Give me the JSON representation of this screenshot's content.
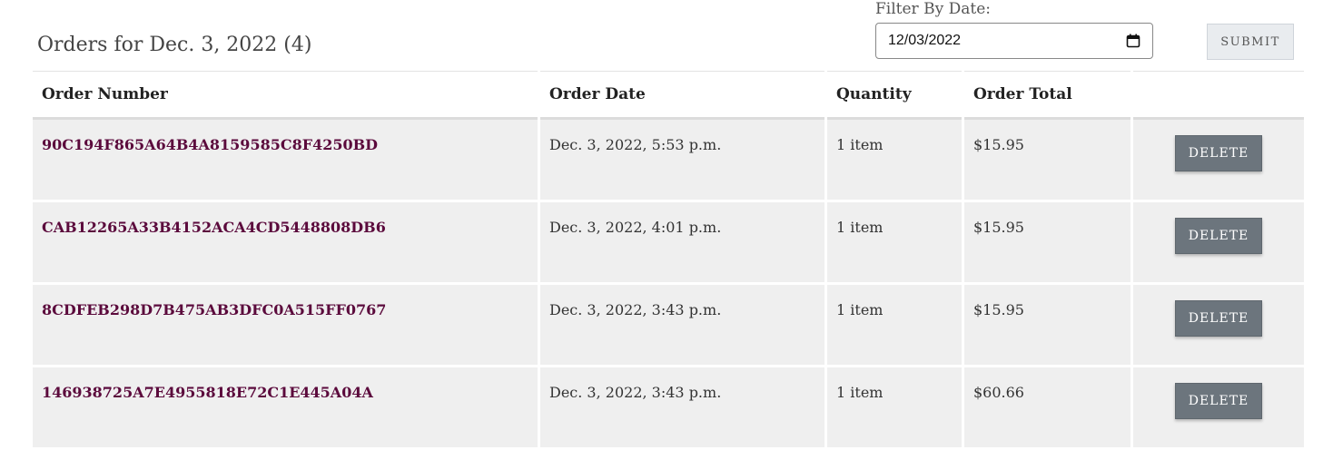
{
  "page": {
    "title": "Orders for Dec. 3, 2022 (4)"
  },
  "filter": {
    "label": "Filter By Date:",
    "date_value": "12/03/2022",
    "submit_label": "SUBMIT"
  },
  "table": {
    "headers": [
      "Order Number",
      "Order Date",
      "Quantity",
      "Order Total",
      ""
    ],
    "rows": [
      {
        "order_number": "90C194F865A64B4A8159585C8F4250BD",
        "date": "Dec. 3, 2022, 5:53 p.m.",
        "quantity": "1 item",
        "total": "$15.95",
        "action": "DELETE"
      },
      {
        "order_number": "CAB12265A33B4152ACA4CD5448808DB6",
        "date": "Dec. 3, 2022, 4:01 p.m.",
        "quantity": "1 item",
        "total": "$15.95",
        "action": "DELETE"
      },
      {
        "order_number": "8CDFEB298D7B475AB3DFC0A515FF0767",
        "date": "Dec. 3, 2022, 3:43 p.m.",
        "quantity": "1 item",
        "total": "$15.95",
        "action": "DELETE"
      },
      {
        "order_number": "146938725A7E4955818E72C1E445A04A",
        "date": "Dec. 3, 2022, 3:43 p.m.",
        "quantity": "1 item",
        "total": "$60.66",
        "action": "DELETE"
      }
    ]
  },
  "colors": {
    "order_link": "#5b0a3c",
    "delete_button": "#6c757d",
    "row_background": "#efefef"
  }
}
